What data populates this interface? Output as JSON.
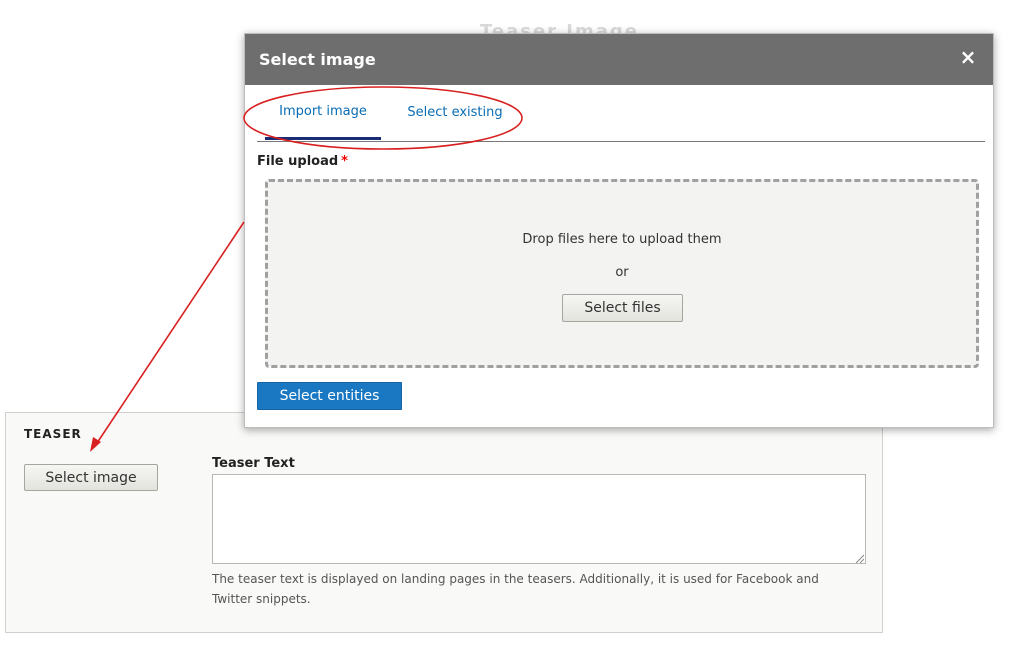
{
  "background_page": {
    "faded_title": "Teaser Image"
  },
  "teaser": {
    "heading": "TEASER",
    "select_image_label": "Select image",
    "text_label": "Teaser Text",
    "text_value": "",
    "description": "The teaser text is displayed on landing pages in the teasers. Additionally, it is used for Facebook and Twitter snippets."
  },
  "dialog": {
    "title": "Select image",
    "close_icon": "×",
    "tabs": [
      {
        "label": "Import image",
        "active": true
      },
      {
        "label": "Select existing",
        "active": false
      }
    ],
    "file_upload_label": "File upload",
    "required_marker": "*",
    "drop_text": "Drop files here to upload them",
    "or_text": "or",
    "select_files_label": "Select files",
    "select_entities_label": "Select entities"
  },
  "annotation": {
    "color": "#d92020"
  },
  "colors": {
    "titlebar": "#6e6e6e",
    "primary_button": "#1a78c2",
    "tab_link": "#0a6cb5",
    "active_tab_underline": "#1a2c73"
  }
}
